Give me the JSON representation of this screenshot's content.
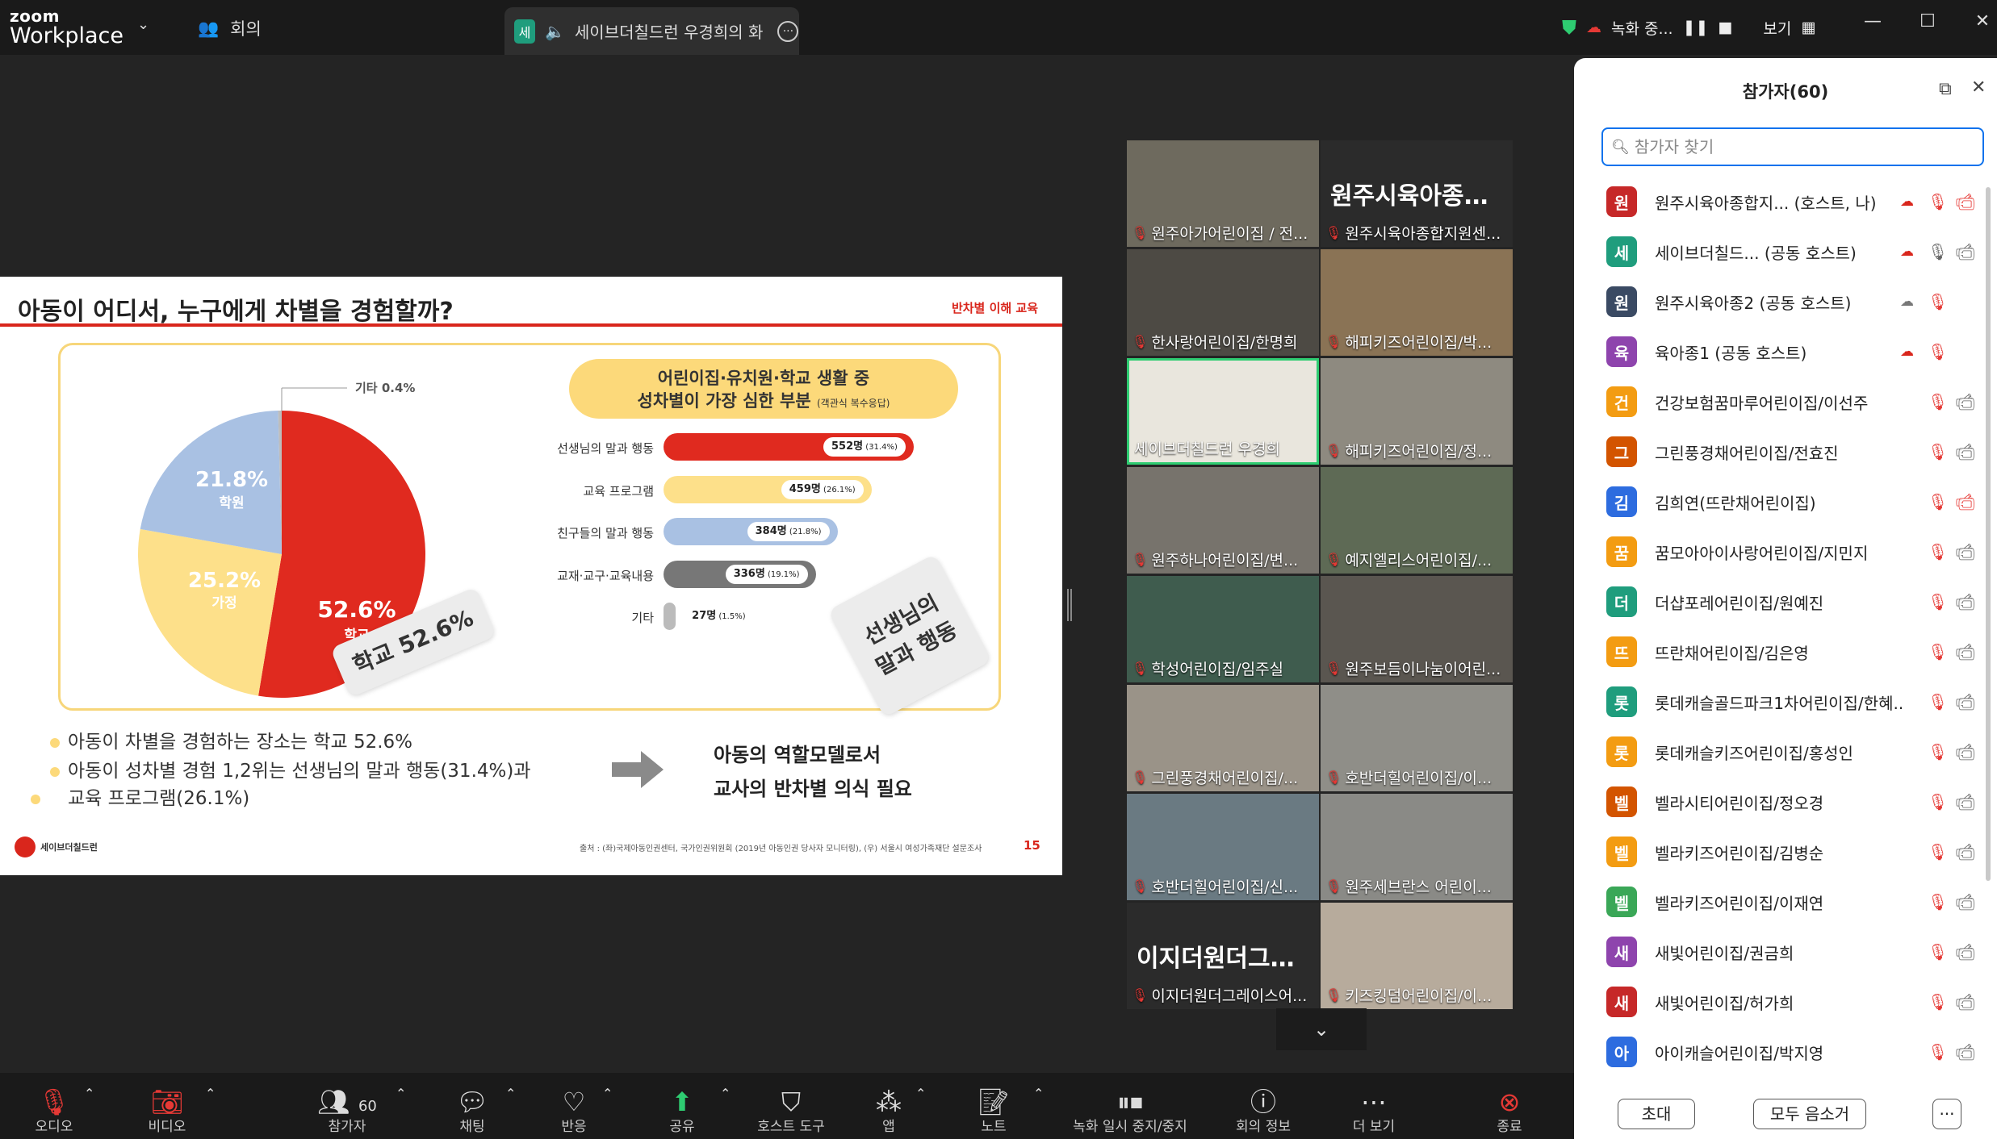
{
  "app": {
    "brand_top": "zoom",
    "brand_bottom": "Workplace",
    "meeting_menu": "회의"
  },
  "tab": {
    "avatar": "세",
    "title": "세이브더칠드런 우경희의 화"
  },
  "topright": {
    "recording": "녹화 중...",
    "view": "보기"
  },
  "slide": {
    "title": "아동이 어디서, 누구에게 차별을 경험할까?",
    "tag": "반차별 이해 교육",
    "pie_labels": {
      "school_pct": "52.6%",
      "school": "학교",
      "academy_pct": "21.8%",
      "academy": "학원",
      "home_pct": "25.2%",
      "home": "가정",
      "other": "기타 0.4%"
    },
    "bar_title_1": "어린이집·유치원·학교 생활 중",
    "bar_title_2": "성차별이 가장 심한 부분",
    "bar_title_note": "(객관식 복수응답)",
    "stamp_school": "학교 52.6%",
    "stamp_teacher_1": "선생님의",
    "stamp_teacher_2": "말과 행동",
    "bullet_1": "아동이 차별을 경험하는 장소는 학교 52.6%",
    "bullet_2": "아동이 성차별 경험 1,2위는 선생님의 말과 행동(31.4%)과",
    "bullet_3": "교육 프로그램(26.1%)",
    "conclusion_1": "아동의 역할모델로서",
    "conclusion_2": "교사의 반차별 의식 필요",
    "footer_logo": "세이브더칠드런",
    "footer_source": "출처 : (좌)국제아동인권센터, 국가인권위원회 (2019년 아동인권 당사자 모니터링), (우) 서울시 여성가족재단 설문조사",
    "page": "15"
  },
  "chart_data": [
    {
      "type": "pie",
      "title": "",
      "series": [
        {
          "values": [
            52.6,
            25.2,
            21.8,
            0.4
          ]
        }
      ],
      "categories": [
        "학교",
        "가정",
        "학원",
        "기타"
      ],
      "colors": [
        "#e02a1f",
        "#fde08a",
        "#a9c1e3",
        "#bdbdbd"
      ]
    },
    {
      "type": "bar",
      "title": "어린이집·유치원·학교 생활 중 성차별이 가장 심한 부분",
      "categories": [
        "선생님의 말과 행동",
        "교육 프로그램",
        "친구들의 말과 행동",
        "교재·교구·교육내용",
        "기타"
      ],
      "values": [
        552,
        459,
        384,
        336,
        27
      ],
      "value_labels": [
        "552명",
        "459명",
        "384명",
        "336명",
        "27명"
      ],
      "percent_labels": [
        "(31.4%)",
        "(26.1%)",
        "(21.8%)",
        "(19.1%)",
        "(1.5%)"
      ],
      "colors": [
        "#e02a1f",
        "#fde08a",
        "#a9c1e3",
        "#777777",
        "#bbbbbb"
      ]
    }
  ],
  "grid": {
    "tiles": [
      {
        "name": "원주아가어린이집 / 전...",
        "big": ""
      },
      {
        "name": "원주시육아종합지원센...",
        "big": "원주시육아종합..."
      },
      {
        "name": "한사랑어린이집/한명희",
        "big": ""
      },
      {
        "name": "해피키즈어린이집/박...",
        "big": ""
      },
      {
        "name": "세이브더칠드런 우경희",
        "big": ""
      },
      {
        "name": "해피키즈어린이집/정...",
        "big": ""
      },
      {
        "name": "원주하나어린이집/변...",
        "big": ""
      },
      {
        "name": "예지엘리스어린이집/...",
        "big": ""
      },
      {
        "name": "학성어린이집/임주실",
        "big": ""
      },
      {
        "name": "원주보듬이나눔이어린...",
        "big": ""
      },
      {
        "name": "그린풍경채어린이집/...",
        "big": ""
      },
      {
        "name": "호반더힐어린이집/이...",
        "big": ""
      },
      {
        "name": "호반더힐어린이집/신...",
        "big": ""
      },
      {
        "name": "원주세브란스 어린이...",
        "big": ""
      },
      {
        "name": "이지더원더그레이스어...",
        "big": "이지더원더그레..."
      },
      {
        "name": "키즈킹덤어린이집/이...",
        "big": ""
      }
    ]
  },
  "panel": {
    "title": "참가자(60)",
    "search_placeholder": "참가자 찾기",
    "participants": [
      {
        "av": "원",
        "name": "원주시육아종합지...   (호스트, 나)",
        "color": "#c62828"
      },
      {
        "av": "세",
        "name": "세이브더칠드...  (공동 호스트)",
        "color": "#1f9d7d"
      },
      {
        "av": "원",
        "name": "원주시육아종2 (공동 호스트)",
        "color": "#3a4a63"
      },
      {
        "av": "육",
        "name": "육아종1 (공동 호스트)",
        "color": "#8e44ad"
      },
      {
        "av": "건",
        "name": "건강보험꿈마루어린이집/이선주",
        "color": "#f39c12"
      },
      {
        "av": "그",
        "name": "그린풍경채어린이집/전효진",
        "color": "#d35400"
      },
      {
        "av": "김",
        "name": "김희연(뜨란채어린이집)",
        "color": "#2d6cdf"
      },
      {
        "av": "꿈",
        "name": "꿈모아아이사랑어린이집/지민지",
        "color": "#f39c12"
      },
      {
        "av": "더",
        "name": "더샵포레어린이집/원예진",
        "color": "#1f9d7d"
      },
      {
        "av": "뜨",
        "name": "뜨란채어린이집/김은영",
        "color": "#f39c12"
      },
      {
        "av": "롯",
        "name": "롯데캐슬골드파크1차어린이집/한혜...",
        "color": "#1f9d7d"
      },
      {
        "av": "롯",
        "name": "롯데캐슬키즈어린이집/홍성인",
        "color": "#f39c12"
      },
      {
        "av": "벨",
        "name": "벨라시티어린이집/정오경",
        "color": "#d35400"
      },
      {
        "av": "벨",
        "name": "벨라키즈어린이집/김병순",
        "color": "#f39c12"
      },
      {
        "av": "벨",
        "name": "벨라키즈어린이집/이재연",
        "color": "#3aa757"
      },
      {
        "av": "새",
        "name": "새빛어린이집/권금희",
        "color": "#8e44ad"
      },
      {
        "av": "새",
        "name": "새빛어린이집/허가희",
        "color": "#c62828"
      },
      {
        "av": "아",
        "name": "아이캐슬어린이집/박지영",
        "color": "#2d6cdf"
      }
    ],
    "invite": "초대",
    "mute_all": "모두 음소거",
    "more": "···"
  },
  "toolbar": {
    "audio": "오디오",
    "video": "비디오",
    "participants": "참가자",
    "participants_count": "60",
    "chat": "채팅",
    "react": "반응",
    "share": "공유",
    "host_tools": "호스트 도구",
    "apps": "앱",
    "notes": "노트",
    "recording": "녹화 일시 중지/중지",
    "info": "회의 정보",
    "more": "더 보기",
    "end": "종료"
  }
}
